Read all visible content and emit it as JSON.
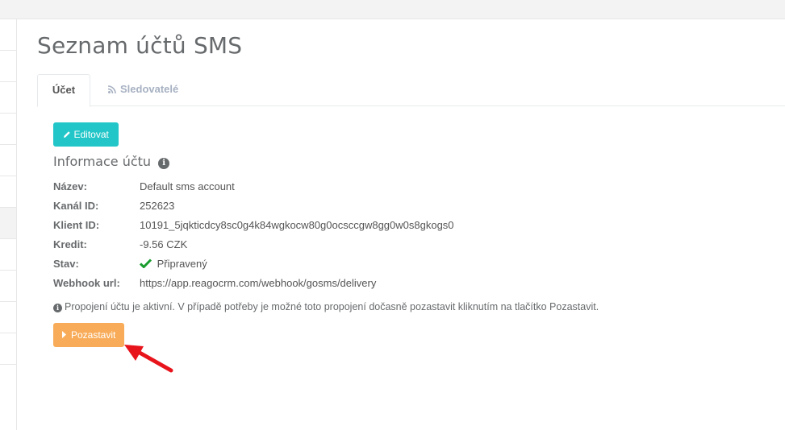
{
  "page": {
    "title": "Seznam účtů SMS"
  },
  "tabs": [
    {
      "label": "Účet",
      "icon": "none",
      "active": true
    },
    {
      "label": "Sledovatelé",
      "icon": "rss-icon",
      "active": false
    }
  ],
  "actions": {
    "edit_label": "Editovat",
    "pause_label": "Pozastavit"
  },
  "section": {
    "title": "Informace účtu"
  },
  "details": [
    {
      "label": "Název:",
      "value": "Default sms account"
    },
    {
      "label": "Kanál ID:",
      "value": "252623"
    },
    {
      "label": "Klient ID:",
      "value": "10191_5jqkticdcy8sc0g4k84wgkocw80g0ocsccgw8gg0w0s8gkogs0"
    },
    {
      "label": "Kredit:",
      "value": "-9.56 CZK"
    },
    {
      "label": "Stav:",
      "value": "Připravený",
      "status_icon": "check-icon"
    },
    {
      "label": "Webhook url:",
      "value": "https://app.reagocrm.com/webhook/gosms/delivery"
    }
  ],
  "note": "Propojení účtu je aktivní. V případě potřeby je možné toto propojení dočasně pozastavit kliknutím na tlačítko Pozastavit.",
  "colors": {
    "edit_button": "#23c6c8",
    "pause_button": "#f8ac59",
    "status_ok": "#1ab394",
    "annotation_arrow": "#e8141c"
  }
}
